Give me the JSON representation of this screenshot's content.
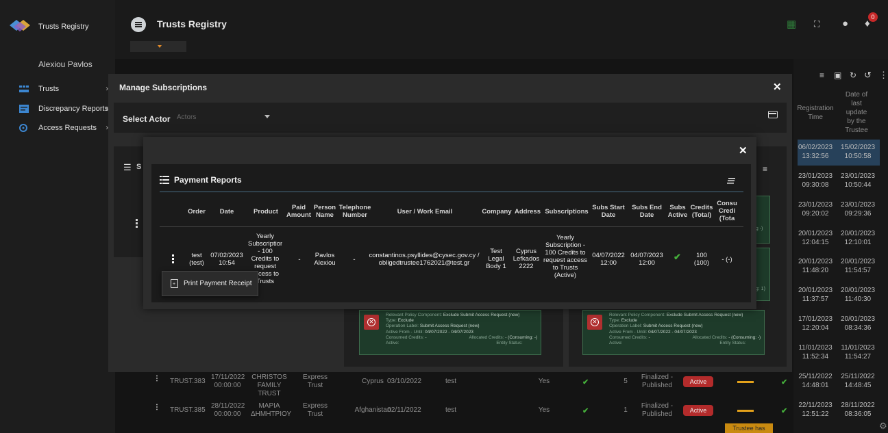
{
  "sidebar": {
    "app_name": "Trusts Registry",
    "user_name": "Alexiou Pavlos",
    "items": [
      {
        "label": "Trusts"
      },
      {
        "label": "Discrepancy Reports"
      },
      {
        "label": "Access Requests"
      }
    ]
  },
  "topbar": {
    "title": "Trusts Registry",
    "notification_count": "0"
  },
  "background_table": {
    "headers": [
      "Registration Time",
      "Date of last update by the Trustee"
    ],
    "rows": [
      [
        "06/02/2023 13:32:56",
        "15/02/2023 10:50:58"
      ],
      [
        "23/01/2023 09:30:08",
        "23/01/2023 10:50:44"
      ],
      [
        "23/01/2023 09:20:02",
        "23/01/2023 09:29:36"
      ],
      [
        "20/01/2023 12:04:15",
        "20/01/2023 12:10:01"
      ],
      [
        "20/01/2023 11:48:20",
        "20/01/2023 11:54:57"
      ],
      [
        "20/01/2023 11:37:57",
        "20/01/2023 11:40:30"
      ],
      [
        "17/01/2023 12:20:04",
        "20/01/2023 08:34:36"
      ],
      [
        "11/01/2023 11:52:34",
        "11/01/2023 11:54:27"
      ],
      [
        "25/11/2022 14:48:01",
        "25/11/2022 14:48:45"
      ],
      [
        "22/11/2023 12:51:22",
        "28/11/2022 08:36:05"
      ]
    ],
    "bottom_rows": [
      {
        "id": "TRUST.383",
        "date": "17/11/2022 00:00:00",
        "name": "CHRISTOS FAMILY TRUST",
        "type": "Express Trust",
        "country": "Cyprus",
        "date2": "03/10/2022",
        "user": "test",
        "yes": "Yes",
        "count": "5",
        "status": "Finalized - Published",
        "badge": "Active"
      },
      {
        "id": "TRUST.385",
        "date": "28/11/2022 00:00:00",
        "name": "ΜΑΡΙΑ ΔΗΜΗΤΡΙΟΥ",
        "type": "Express Trust",
        "country": "Afghanistan",
        "date2": "02/11/2022",
        "user": "test",
        "yes": "Yes",
        "count": "1",
        "status": "Finalized - Published",
        "badge": "Active"
      }
    ],
    "trustee_badge": "Trustee has",
    "side_snippets": [
      "ng -)",
      "ng: 1)"
    ]
  },
  "manage": {
    "title": "Manage Subscriptions",
    "select_actor_label": "Select Actor",
    "actor_placeholder": "Actors",
    "section_label_stub": "S"
  },
  "policies": [
    {
      "component": "Exclude Submit Access Request (new)",
      "type": "Exclude",
      "operation": "Submit Access Request (new)",
      "active": "04/07/2022 - 04/07/2023",
      "consumed": "-",
      "allocated": "- (Consuming: -)",
      "label_component": "Relevant Policy Component:",
      "label_type": "Type:",
      "label_operation": "Operation Label:",
      "label_active": "Active From - Until:",
      "label_consumed": "Consumed Credits:",
      "label_allocated": "Allocated Credits:",
      "label_active2": "Active:",
      "label_entity": "Entity Status:"
    }
  ],
  "payment": {
    "title": "Payment Reports",
    "headers": {
      "order": "Order",
      "date": "Date",
      "product": "Product",
      "paid": "Paid Amount",
      "person": "Person Name",
      "tel": "Telephone Number",
      "email": "User / Work Email",
      "company": "Company",
      "address": "Address",
      "subs": "Subscriptions",
      "start": "Subs Start Date",
      "end": "Subs End Date",
      "active": "Subs Active",
      "credits": "Credits (Total)",
      "consumed": "Consu Credi (Tota"
    },
    "row": {
      "order": "test (test)",
      "date": "07/02/2023 10:54",
      "product": "Yearly Subscription - 100 Credits to request access to Trusts",
      "paid": "-",
      "person": "Pavlos Alexiou",
      "tel": "-",
      "email": "constantinos.psyllides@cysec.gov.cy / obligedtrustee1762021@test.gr",
      "company": "Test Legal Body 1",
      "address": "Cyprus Lefkados 2222",
      "subs": "Yearly Subscription - 100 Credits to request access to Trusts (Active)",
      "start": "04/07/2022 12:00",
      "end": "04/07/2023 12:00",
      "credits": "100 (100)",
      "consumed": "- (-)"
    },
    "popup_label": "Print Payment Receipt"
  }
}
